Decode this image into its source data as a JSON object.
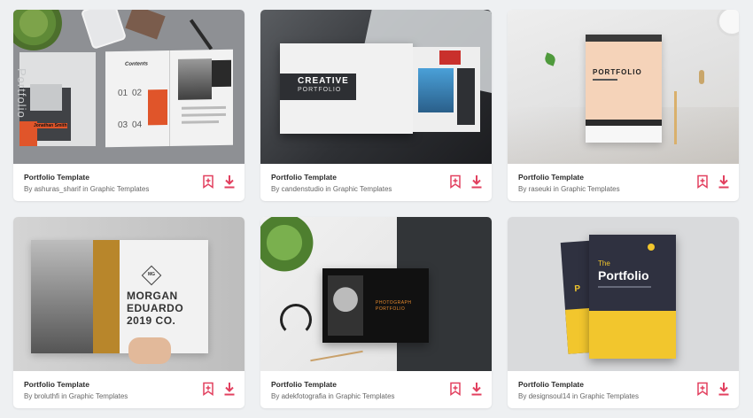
{
  "accent": "#e2405f",
  "cards": [
    {
      "title": "Portfolio Template",
      "by": "By",
      "author": "ashuras_sharif",
      "in": "in",
      "category": "Graphic Templates",
      "thumb": {
        "spine": "Portfolio",
        "contents": "Contents",
        "n1": "01",
        "n2": "02",
        "n3": "03",
        "n4": "04",
        "name": "Jonathan Smith"
      }
    },
    {
      "title": "Portfolio Template",
      "by": "By",
      "author": "candenstudio",
      "in": "in",
      "category": "Graphic Templates",
      "thumb": {
        "line1": "CREATIVE",
        "line2": "PORTFOLIO"
      }
    },
    {
      "title": "Portfolio Template",
      "by": "By",
      "author": "raseuki",
      "in": "in",
      "category": "Graphic Templates",
      "thumb": {
        "word": "PORTFOLIO"
      }
    },
    {
      "title": "Portfolio Template",
      "by": "By",
      "author": "broluthfi",
      "in": "in",
      "category": "Graphic Templates",
      "thumb": {
        "badge": "MG",
        "l1": "MORGAN",
        "l2": "EDUARDO",
        "l3": "2019 CO."
      }
    },
    {
      "title": "Portfolio Template",
      "by": "By",
      "author": "adekfotografia",
      "in": "in",
      "category": "Graphic Templates",
      "thumb": {
        "l1": "PHOTOGRAPH",
        "l2": "PORTFOLIO"
      }
    },
    {
      "title": "Portfolio Template",
      "by": "By",
      "author": "designsoul14",
      "in": "in",
      "category": "Graphic Templates",
      "thumb": {
        "the": "The",
        "word": "Portfolio"
      }
    }
  ]
}
